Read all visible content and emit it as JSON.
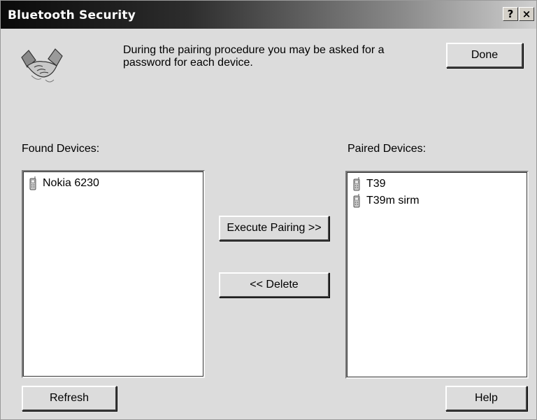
{
  "window": {
    "title": "Bluetooth Security",
    "help_glyph": "?",
    "close_glyph": "×"
  },
  "header": {
    "logo_icon": "handshake-icon",
    "message": "During the pairing procedure you may be asked for a password for each device.",
    "done_label": "Done"
  },
  "found": {
    "label": "Found Devices:",
    "devices": [
      {
        "name": "Nokia 6230",
        "icon": "mobile-phone-icon"
      }
    ]
  },
  "paired": {
    "label": "Paired Devices:",
    "devices": [
      {
        "name": "T39",
        "icon": "mobile-phone-icon"
      },
      {
        "name": "T39m sirm",
        "icon": "mobile-phone-icon"
      }
    ]
  },
  "actions": {
    "execute_label": "Execute Pairing >>",
    "delete_label": "<< Delete",
    "refresh_label": "Refresh",
    "help_label": "Help"
  }
}
